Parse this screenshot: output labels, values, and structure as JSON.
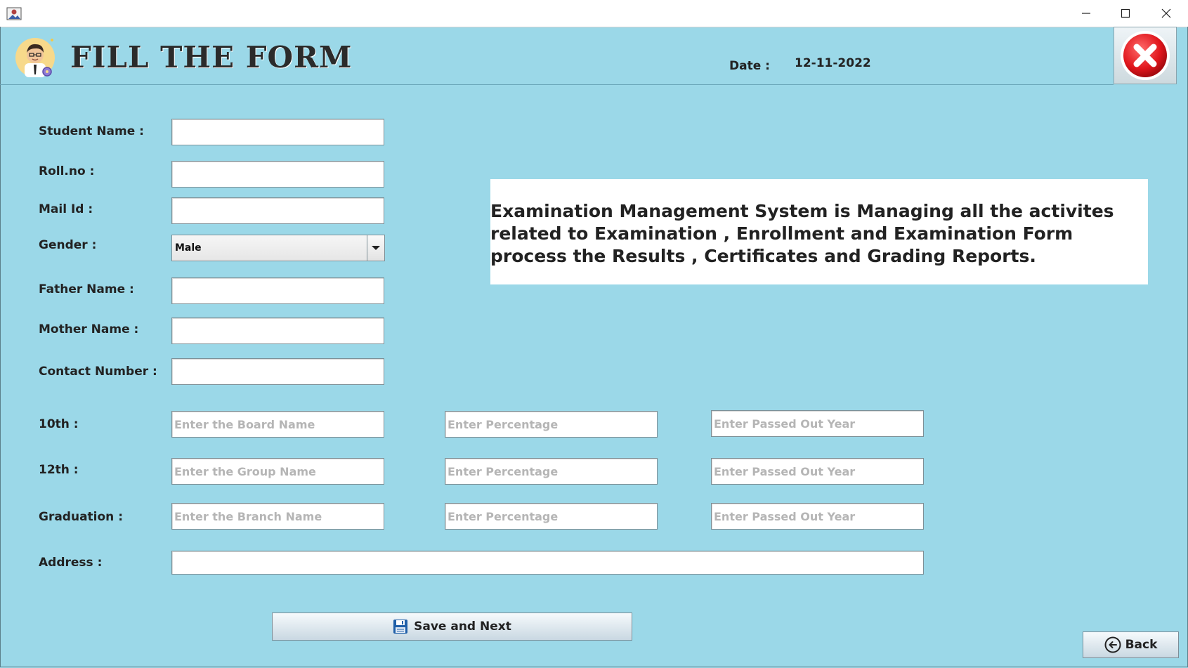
{
  "window": {
    "controls": [
      "minimize",
      "maximize",
      "close"
    ]
  },
  "header": {
    "title": "FILL THE FORM",
    "date_label": "Date :",
    "date_value": "12-11-2022"
  },
  "form": {
    "student_name_label": "Student Name :",
    "roll_no_label": "Roll.no :",
    "mail_id_label": "Mail Id :",
    "gender_label": "Gender :",
    "gender_value": "Male",
    "father_name_label": "Father Name :",
    "mother_name_label": "Mother Name :",
    "contact_number_label": "Contact Number :",
    "tenth_label": "10th :",
    "twelfth_label": "12th :",
    "graduation_label": "Graduation  :",
    "address_label": "Address :",
    "placeholders": {
      "board_name": "Enter the Board Name",
      "group_name": "Enter the Group Name",
      "branch_name": "Enter the Branch Name",
      "percentage": "Enter Percentage",
      "passed_out_year": "Enter Passed Out Year"
    }
  },
  "info": {
    "text": "Examination Management System is Managing all the activites related to Examination , Enrollment and Examination Form process the Results , Certificates and Grading Reports."
  },
  "buttons": {
    "save_label": "Save and Next",
    "back_label": "Back"
  },
  "colors": {
    "background": "#9bd8e8",
    "close_red": "#e0161c"
  },
  "icons": [
    "app-icon",
    "student-avatar-icon",
    "close-circle-icon",
    "floppy-disk-icon",
    "back-arrow-icon",
    "dropdown-arrow-icon"
  ]
}
